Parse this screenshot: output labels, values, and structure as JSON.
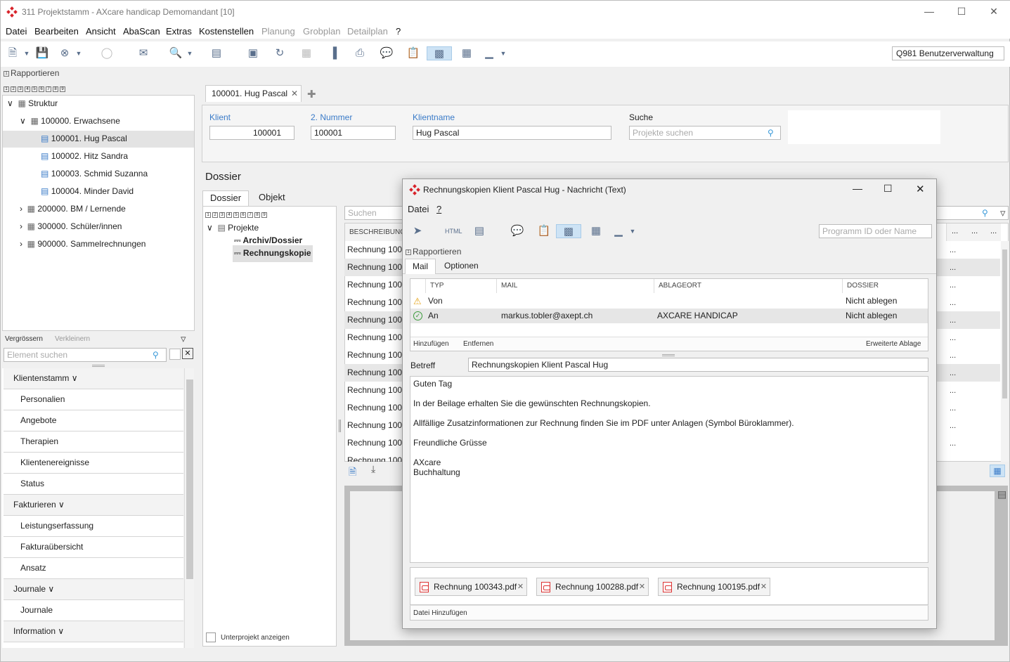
{
  "window": {
    "title": "311 Projektstamm - AXcare handicap Demomandant [10]"
  },
  "menu": [
    "Datei",
    "Bearbeiten",
    "Ansicht",
    "AbaScan",
    "Extras",
    "Kostenstellen",
    "Planung",
    "Grobplan",
    "Detailplan",
    "?"
  ],
  "program_id_input": "Q981 Benutzerverwaltung",
  "rapportieren": "Rapportieren",
  "level_numbers": [
    "1",
    "2",
    "3",
    "4",
    "5",
    "6",
    "7",
    "8",
    "9"
  ],
  "tree": {
    "root": "Struktur",
    "group1": "100000. Erwachsene",
    "items": [
      "100001. Hug Pascal",
      "100002. Hitz Sandra",
      "100003. Schmid Suzanna",
      "100004. Minder David"
    ],
    "group2": "200000. BM / Lernende",
    "group3": "300000. Schüler/innen",
    "group4": "900000. Sammelrechnungen"
  },
  "left_tools": {
    "enlarge": "Vergrössern",
    "shrink": "Verkleinern",
    "search_placeholder": "Element suchen"
  },
  "nav": {
    "sections": [
      {
        "label": "Klientenstamm",
        "items": [
          "Personalien",
          "Angebote",
          "Therapien",
          "Klientenereignisse",
          "Status"
        ]
      },
      {
        "label": "Fakturieren",
        "items": [
          "Leistungserfassung",
          "Fakturaübersicht",
          "Ansatz"
        ]
      },
      {
        "label": "Journale",
        "items": [
          "Journale"
        ]
      },
      {
        "label": "Information",
        "items": []
      }
    ]
  },
  "record_tab": "100001. Hug Pascal",
  "fields": {
    "klient_label": "Klient",
    "klient_value": "100001",
    "nummer_label": "2. Nummer",
    "nummer_value": "100001",
    "name_label": "Klientname",
    "name_value": "Hug Pascal",
    "suche_label": "Suche",
    "suche_placeholder": "Projekte suchen"
  },
  "dossier": {
    "title": "Dossier",
    "tabs": [
      "Dossier",
      "Objekt"
    ],
    "tree_root": "Projekte",
    "tree_items": [
      "Archiv/Dossier",
      "Rechnungskopie"
    ],
    "subproject": "Unterprojekt anzeigen",
    "search_placeholder": "Suchen",
    "col_header": "BESCHREIBUNG",
    "rows": [
      "Rechnung 100",
      "Rechnung 100",
      "Rechnung 100",
      "Rechnung 100",
      "Rechnung 100",
      "Rechnung 100",
      "Rechnung 100",
      "Rechnung 100",
      "Rechnung 100",
      "Rechnung 100",
      "Rechnung 100",
      "Rechnung 100",
      "Rechnung 100"
    ],
    "dots": "..."
  },
  "dialog": {
    "title": "Rechnungskopien Klient Pascal Hug - Nachricht (Text)",
    "menu": [
      "Datei",
      "?"
    ],
    "progid_placeholder": "Programm ID oder Name",
    "rapportieren": "Rapportieren",
    "tabs": [
      "Mail",
      "Optionen"
    ],
    "grid_headers": [
      "TYP",
      "MAIL",
      "ABLAGEORT",
      "DOSSIER"
    ],
    "rows": [
      {
        "typ": "Von",
        "mail": "",
        "ablageort": "",
        "dossier": "Nicht ablegen"
      },
      {
        "typ": "An",
        "mail": "markus.tobler@axept.ch",
        "ablageort": "AXCARE HANDICAP",
        "dossier": "Nicht ablegen"
      }
    ],
    "grid_actions": {
      "add": "Hinzufügen",
      "remove": "Entfernen",
      "extended": "Erweiterte Ablage"
    },
    "subject_label": "Betreff",
    "subject_value": "Rechnungskopien Klient Pascal Hug",
    "body": [
      "Guten Tag",
      "",
      "In der Beilage erhalten Sie die gewünschten Rechnungskopien.",
      "",
      "Allfällige Zusatzinformationen zur Rechnung finden Sie im PDF unter Anlagen (Symbol Büroklammer).",
      "",
      "Freundliche Grüsse",
      "",
      "AXcare",
      "Buchhaltung"
    ],
    "attachments": [
      "Rechnung 100343.pdf",
      "Rechnung 100288.pdf",
      "Rechnung 100195.pdf"
    ],
    "add_file": "Datei Hinzufügen"
  },
  "colors": {
    "accent": "#3a7bc8",
    "logo": "#d8232a",
    "selected_row": "#e3e3e3"
  }
}
